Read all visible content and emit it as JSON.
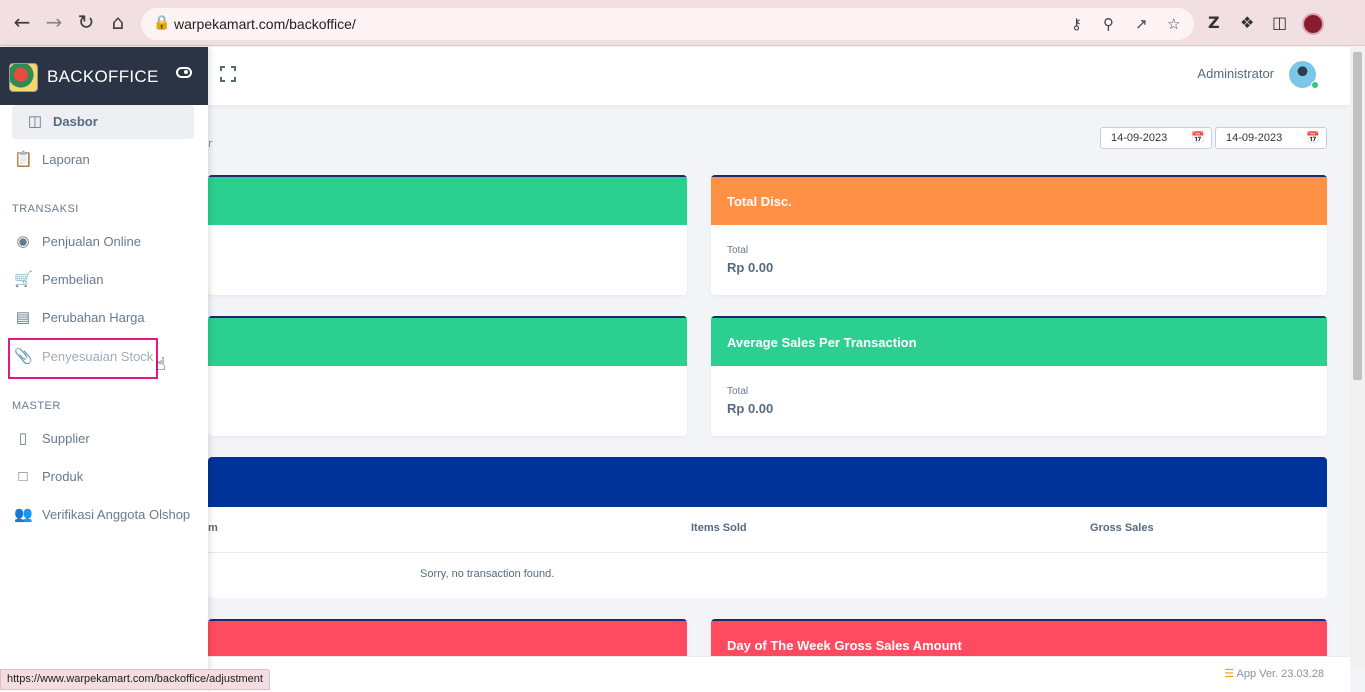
{
  "browser": {
    "url": "warpekamart.com/backoffice/",
    "status_link": "https://www.warpekamart.com/backoffice/adjustment"
  },
  "sidebar": {
    "brand": "BACKOFFICE",
    "items": [
      {
        "label": "Dasbor",
        "icon": "dashboard-icon"
      },
      {
        "label": "Laporan",
        "icon": "clipboard-icon"
      }
    ],
    "section_transaksi": "TRANSAKSI",
    "transaksi_items": [
      {
        "label": "Penjualan Online",
        "icon": "broadcast-icon"
      },
      {
        "label": "Pembelian",
        "icon": "cart-icon"
      },
      {
        "label": "Perubahan Harga",
        "icon": "calculator-icon"
      },
      {
        "label": "Penyesuaian Stock",
        "icon": "paperclip-icon"
      }
    ],
    "section_master": "MASTER",
    "master_items": [
      {
        "label": "Supplier",
        "icon": "book-icon"
      },
      {
        "label": "Produk",
        "icon": "box-icon"
      },
      {
        "label": "Verifikasi Anggota Olshop",
        "icon": "users-icon"
      }
    ]
  },
  "topbar": {
    "user": "Administrator"
  },
  "filters": {
    "date_from": "14-09-2023",
    "date_to": "14-09-2023",
    "stray_text": "r"
  },
  "cards": {
    "total_disc": {
      "title": "Total Disc.",
      "label": "Total",
      "value": "Rp 0.00"
    },
    "avg_sales": {
      "title": "Average Sales Per Transaction",
      "label": "Total",
      "value": "Rp 0.00"
    },
    "day_of_week": {
      "title": "Day of The Week Gross Sales Amount"
    }
  },
  "table": {
    "col_item": "m",
    "col_sold": "Items Sold",
    "col_gross": "Gross Sales",
    "empty": "Sorry, no transaction found."
  },
  "footer": {
    "version": "App Ver. 23.03.28"
  },
  "colors": {
    "green": "#2bd091",
    "orange": "#ff9147",
    "red": "#ff4b5f",
    "navy": "#003399",
    "sidebar_head": "#2b3445",
    "highlight": "#e6177e"
  }
}
